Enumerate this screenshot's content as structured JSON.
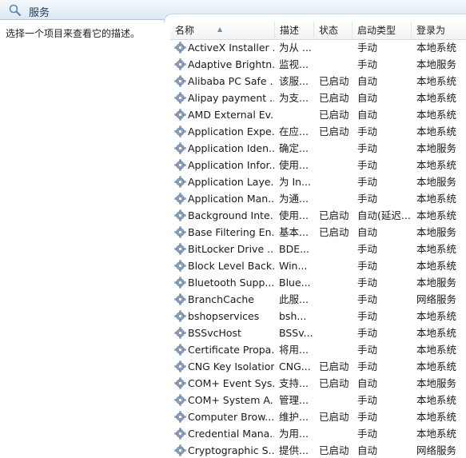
{
  "window": {
    "title": "服务",
    "icon": "services-magnifier-icon"
  },
  "left_pane": {
    "description": "选择一个项目来查看它的描述。"
  },
  "columns": [
    "名称",
    "描述",
    "状态",
    "启动类型",
    "登录为"
  ],
  "services": [
    {
      "name": "ActiveX Installer ...",
      "desc": "为从 ...",
      "status": "",
      "startup": "手动",
      "logon": "本地系统"
    },
    {
      "name": "Adaptive Brightn...",
      "desc": "监视...",
      "status": "",
      "startup": "手动",
      "logon": "本地服务"
    },
    {
      "name": "Alibaba PC Safe ...",
      "desc": "该服...",
      "status": "已启动",
      "startup": "自动",
      "logon": "本地系统"
    },
    {
      "name": "Alipay payment ...",
      "desc": "为支...",
      "status": "已启动",
      "startup": "自动",
      "logon": "本地系统"
    },
    {
      "name": "AMD External Ev...",
      "desc": "",
      "status": "已启动",
      "startup": "自动",
      "logon": "本地系统"
    },
    {
      "name": "Application Expe...",
      "desc": "在应...",
      "status": "已启动",
      "startup": "手动",
      "logon": "本地系统"
    },
    {
      "name": "Application Iden...",
      "desc": "确定...",
      "status": "",
      "startup": "手动",
      "logon": "本地服务"
    },
    {
      "name": "Application Infor...",
      "desc": "使用...",
      "status": "",
      "startup": "手动",
      "logon": "本地系统"
    },
    {
      "name": "Application Laye...",
      "desc": "为 In...",
      "status": "",
      "startup": "手动",
      "logon": "本地服务"
    },
    {
      "name": "Application Man...",
      "desc": "为通...",
      "status": "",
      "startup": "手动",
      "logon": "本地系统"
    },
    {
      "name": "Background Inte...",
      "desc": "使用...",
      "status": "已启动",
      "startup": "自动(延迟...",
      "logon": "本地系统"
    },
    {
      "name": "Base Filtering En...",
      "desc": "基本...",
      "status": "已启动",
      "startup": "自动",
      "logon": "本地服务"
    },
    {
      "name": "BitLocker Drive ...",
      "desc": "BDE...",
      "status": "",
      "startup": "手动",
      "logon": "本地系统"
    },
    {
      "name": "Block Level Back...",
      "desc": "Win...",
      "status": "",
      "startup": "手动",
      "logon": "本地系统"
    },
    {
      "name": "Bluetooth Supp...",
      "desc": "Blue...",
      "status": "",
      "startup": "手动",
      "logon": "本地服务"
    },
    {
      "name": "BranchCache",
      "desc": "此服...",
      "status": "",
      "startup": "手动",
      "logon": "网络服务"
    },
    {
      "name": "bshopservices",
      "desc": "bsh...",
      "status": "",
      "startup": "手动",
      "logon": "本地系统"
    },
    {
      "name": "BSSvcHost",
      "desc": "BSSv...",
      "status": "",
      "startup": "手动",
      "logon": "本地系统"
    },
    {
      "name": "Certificate Propa...",
      "desc": "将用...",
      "status": "",
      "startup": "手动",
      "logon": "本地系统"
    },
    {
      "name": "CNG Key Isolation",
      "desc": "CNG...",
      "status": "已启动",
      "startup": "手动",
      "logon": "本地系统"
    },
    {
      "name": "COM+ Event Sys...",
      "desc": "支持...",
      "status": "已启动",
      "startup": "自动",
      "logon": "本地服务"
    },
    {
      "name": "COM+ System A...",
      "desc": "管理...",
      "status": "",
      "startup": "手动",
      "logon": "本地系统"
    },
    {
      "name": "Computer Brow...",
      "desc": "维护...",
      "status": "已启动",
      "startup": "手动",
      "logon": "本地系统"
    },
    {
      "name": "Credential Mana...",
      "desc": "为用...",
      "status": "",
      "startup": "手动",
      "logon": "本地系统"
    },
    {
      "name": "Cryptographic S...",
      "desc": "提供...",
      "status": "已启动",
      "startup": "自动",
      "logon": "网络服务"
    }
  ]
}
